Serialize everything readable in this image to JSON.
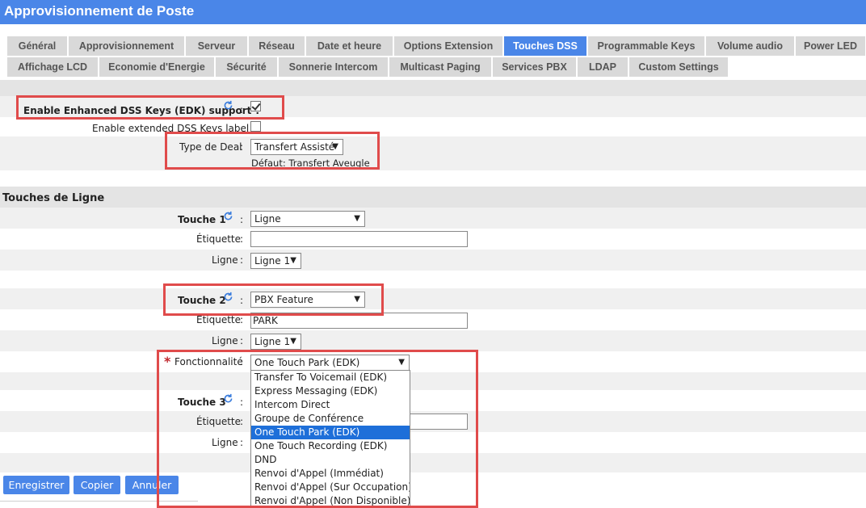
{
  "window": {
    "title": "Approvisionnement de Poste"
  },
  "tabs": {
    "row1": [
      "Général",
      "Approvisionnement",
      "Serveur",
      "Réseau",
      "Date et heure",
      "Options Extension",
      "Touches DSS",
      "Programmable Keys",
      "Volume audio",
      "Power LED"
    ],
    "row2": [
      "Affichage LCD",
      "Economie d'Energie",
      "Sécurité",
      "Sonnerie Intercom",
      "Multicast Paging",
      "Services PBX",
      "LDAP",
      "Custom Settings"
    ],
    "active": "Touches DSS"
  },
  "edk": {
    "label": "Enable Enhanced DSS Keys (EDK) support ?",
    "checked": true,
    "ext_label": "Enable extended DSS Keys label ?",
    "ext_checked": false
  },
  "deal": {
    "label": "Type de Deal",
    "value": "Transfert Assisté",
    "default_text": "Défaut: Transfert Aveugle"
  },
  "section": {
    "title": "Touches de Ligne"
  },
  "key1": {
    "label": "Touche 1",
    "type": "Ligne",
    "etiquette_label": "Étiquette",
    "etiquette_value": "",
    "ligne_label": "Ligne",
    "ligne_value": "Ligne 1"
  },
  "key2": {
    "label": "Touche 2",
    "type": "PBX Feature",
    "etiquette_label": "Étiquette",
    "etiquette_value": "PARK",
    "ligne_label": "Ligne",
    "ligne_value": "Ligne 1",
    "fonction_label": "Fonctionnalité",
    "fonction_value": "One Touch Park (EDK)"
  },
  "key3": {
    "label": "Touche 3",
    "etiquette_label": "Étiquette",
    "ligne_label": "Ligne"
  },
  "common": {
    "colon": ":",
    "required": "*",
    "arrow": "▼"
  },
  "dropdown": {
    "options": [
      "Transfer To Voicemail (EDK)",
      "Express Messaging (EDK)",
      "Intercom Direct",
      "Groupe de Conférence",
      "One Touch Park (EDK)",
      "One Touch Recording (EDK)",
      "DND",
      "Renvoi d'Appel (Immédiat)",
      "Renvoi d'Appel (Sur Occupation)",
      "Renvoi d'Appel (Non Disponible)"
    ],
    "selected_index": 4
  },
  "buttons": {
    "save": "Enregistrer",
    "copy": "Copier",
    "cancel": "Annuler"
  },
  "colors": {
    "accent": "#4a86e8",
    "highlight_box": "#e04b4b",
    "selected": "#1e6fd9"
  }
}
